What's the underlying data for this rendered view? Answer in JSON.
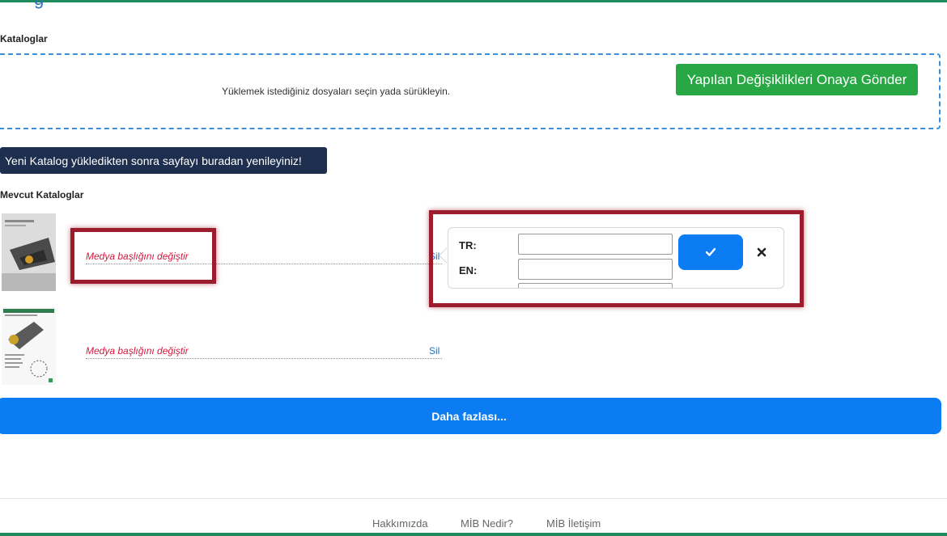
{
  "page": {
    "title_fragment": "g"
  },
  "catalogs_section": {
    "label": "Kataloglar",
    "dropzone_text": "Yüklemek istediğiniz dosyaları seçin yada sürükleyin.",
    "submit_label": "Yapılan Değişiklikleri Onaya Gönder"
  },
  "refresh": {
    "label": "Yeni Katalog yükledikten sonra sayfayı buradan yenileyiniz!"
  },
  "existing": {
    "label": "Mevcut Kataloglar",
    "items": [
      {
        "edit_label": "Medya başlığını değiştir",
        "delete_label": "Sil"
      },
      {
        "edit_label": "Medya başlığını değiştir",
        "delete_label": "Sil"
      }
    ]
  },
  "editor": {
    "tr_label": "TR:",
    "en_label": "EN:",
    "tr_value": "",
    "en_value": "",
    "confirm_icon": "check-icon",
    "close_icon": "close-icon"
  },
  "more": {
    "label": "Daha fazlası..."
  },
  "footer": {
    "links": [
      "Hakkımızda",
      "MİB Nedir?",
      "MİB İletişim"
    ]
  },
  "colors": {
    "accent_green": "#28a745",
    "primary_blue": "#0b7cf2",
    "dark_navy": "#1d2e4e",
    "highlight_red": "#9b1c2c",
    "link_red": "#d6163c"
  }
}
